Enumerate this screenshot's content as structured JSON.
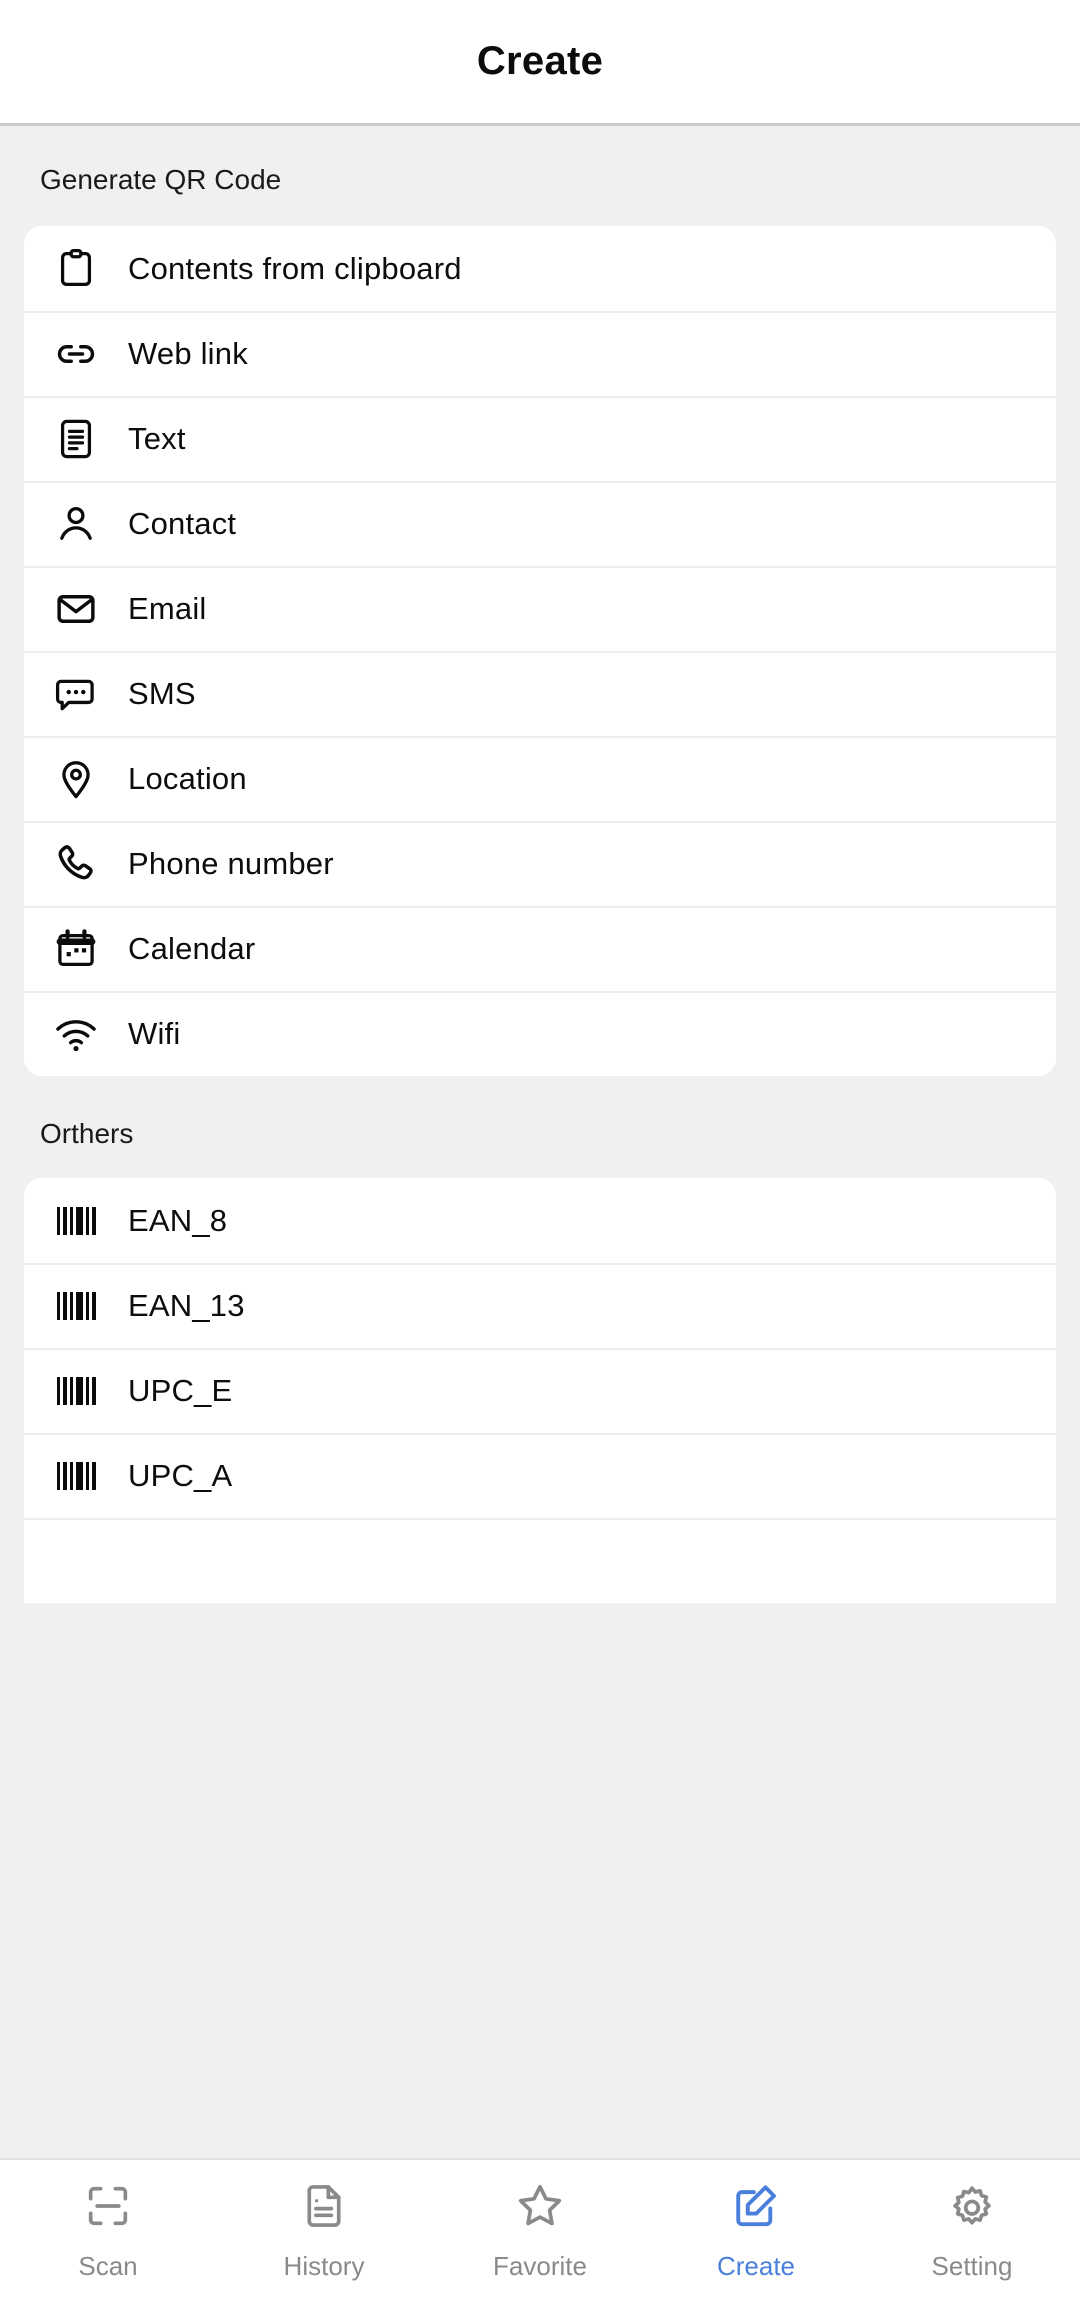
{
  "header": {
    "title": "Create"
  },
  "sections": [
    {
      "title": "Generate QR Code",
      "items": [
        {
          "label": "Contents from clipboard",
          "icon": "clipboard-icon"
        },
        {
          "label": "Web link",
          "icon": "link-icon"
        },
        {
          "label": "Text",
          "icon": "document-text-icon"
        },
        {
          "label": "Contact",
          "icon": "person-icon"
        },
        {
          "label": "Email",
          "icon": "envelope-icon"
        },
        {
          "label": "SMS",
          "icon": "chat-bubble-icon"
        },
        {
          "label": "Location",
          "icon": "map-pin-icon"
        },
        {
          "label": "Phone number",
          "icon": "phone-icon"
        },
        {
          "label": "Calendar",
          "icon": "calendar-icon"
        },
        {
          "label": "Wifi",
          "icon": "wifi-icon"
        }
      ]
    },
    {
      "title": "Orthers",
      "items": [
        {
          "label": "EAN_8",
          "icon": "barcode-icon"
        },
        {
          "label": "EAN_13",
          "icon": "barcode-icon"
        },
        {
          "label": "UPC_E",
          "icon": "barcode-icon"
        },
        {
          "label": "UPC_A",
          "icon": "barcode-icon"
        }
      ]
    }
  ],
  "bottom_nav": {
    "active_color": "#4a7fdc",
    "inactive_color": "#8a8a8a",
    "items": [
      {
        "label": "Scan",
        "icon": "scan-frame-icon",
        "active": false
      },
      {
        "label": "History",
        "icon": "document-icon",
        "active": false
      },
      {
        "label": "Favorite",
        "icon": "star-icon",
        "active": false
      },
      {
        "label": "Create",
        "icon": "edit-square-icon",
        "active": true
      },
      {
        "label": "Setting",
        "icon": "gear-icon",
        "active": false
      }
    ]
  }
}
